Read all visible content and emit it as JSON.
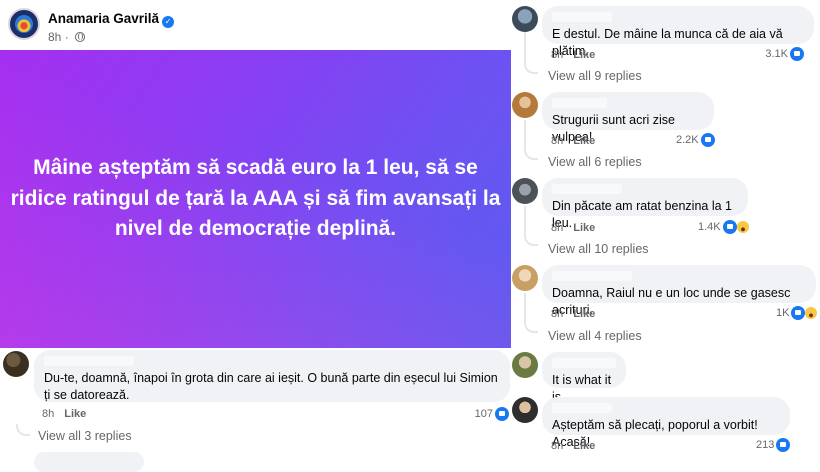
{
  "post": {
    "author": "Anamaria Gavrilă",
    "time": "8h",
    "image_text": "Mâine așteptăm să scadă euro la 1 leu, să se ridice ratingul de țară la AAA și să fim avansați la nivel de democrație deplină."
  },
  "left_comment": {
    "text": "Du-te, doamnă, înapoi în grota din care ai ieșit. O bună parte din eșecul lui Simion ți se datorează.",
    "time": "8h",
    "like_label": "Like",
    "reaction_count": "107",
    "view_replies": "View all 3 replies"
  },
  "comments": [
    {
      "text": "E destul. De mâine la munca că de aia vă plătim.",
      "time": "8h",
      "like_label": "Like",
      "reaction_count": "3.1K",
      "reactions": [
        "like-icon"
      ],
      "view_replies": "View all 9 replies"
    },
    {
      "text": "Strugurii sunt acri zise vulpea!",
      "time": "8h",
      "like_label": "Like",
      "reaction_count": "2.2K",
      "reactions": [
        "like-icon"
      ],
      "view_replies": "View all 6 replies"
    },
    {
      "text": "Din păcate am ratat benzina la 1 leu.",
      "time": "8h",
      "like_label": "Like",
      "reaction_count": "1.4K",
      "reactions": [
        "like-icon",
        "haha-icon"
      ],
      "view_replies": "View all 10 replies"
    },
    {
      "text": "Doamna, Raiul nu e un loc unde se gasesc acrituri.",
      "time": "8h",
      "like_label": "Like",
      "reaction_count": "1K",
      "reactions": [
        "like-icon",
        "haha-icon"
      ],
      "view_replies": "View all 4 replies"
    },
    {
      "text": "It is what it is",
      "time": "",
      "like_label": "",
      "reaction_count": "",
      "reactions": [],
      "view_replies": ""
    },
    {
      "text": "Așteptăm să plecați, poporul a vorbit! Acasă!",
      "time": "8h",
      "like_label": "Like",
      "reaction_count": "213",
      "reactions": [
        "like-icon"
      ],
      "view_replies": ""
    }
  ],
  "colors": {
    "like_blue": "#1877f2",
    "bubble_bg": "#f0f2f5",
    "meta_gray": "#65676b"
  }
}
